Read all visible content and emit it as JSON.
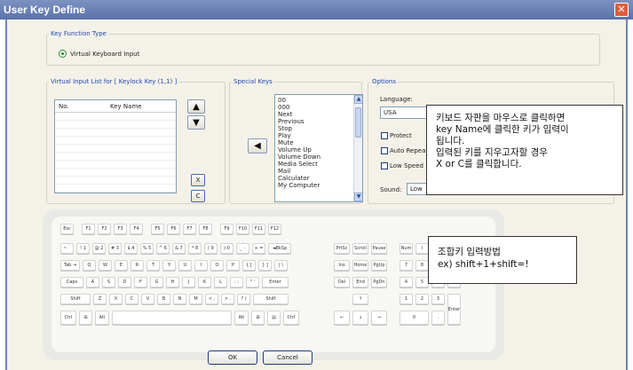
{
  "window": {
    "title": "User Key Define",
    "close_glyph": "✕"
  },
  "key_function": {
    "legend": "Key Function Type",
    "option": "Virtual Keyboard Input"
  },
  "virtual_list": {
    "legend": "Virtual Input List for [ Keylock Key (1,1) ]",
    "columns": [
      "No.",
      "Key Name"
    ],
    "up_glyph": "▲",
    "down_glyph": "▼",
    "delete_label": "X",
    "clear_label": "C"
  },
  "special_keys": {
    "legend": "Special Keys",
    "add_glyph": "◀",
    "items": [
      "00",
      "000",
      "Next",
      "Previous",
      "Stop",
      "Play",
      "Mute",
      "Volume Up",
      "Volume Down",
      "Media Select",
      "Mail",
      "Calculator",
      "My Computer"
    ],
    "scroll_up": "▲",
    "scroll_down": "▼"
  },
  "options": {
    "legend": "Options",
    "language_label": "Language:",
    "language_value": "USA",
    "protect": "Protect",
    "auto_repeat": "Auto Repeat",
    "low_speed": "Low Speed",
    "sound_label": "Sound:",
    "sound_value": "Low"
  },
  "callouts": {
    "top": [
      "키보드 자판을 마우스로 클릭하면",
      "key Name에 클릭한 키가 입력이",
      "됩니다.",
      "입력된 키를 지우고자할 경우",
      "X or C를 클릭합니다."
    ],
    "bottom": [
      "조합키 입력방법",
      "ex) shift+1+shift=!"
    ]
  },
  "keyboard": {
    "fn_row": [
      "Esc",
      "F1",
      "F2",
      "F3",
      "F4",
      "F5",
      "F6",
      "F7",
      "F8",
      "F9",
      "F10",
      "F11",
      "F12"
    ],
    "num_row": [
      "~ `",
      "! 1",
      "@ 2",
      "# 3",
      "$ 4",
      "% 5",
      "^ 6",
      "& 7",
      "* 8",
      "( 9",
      ") 0",
      "_ -",
      "+ =",
      "◄BkSp"
    ],
    "tab_row": [
      "Tab ⇥",
      "Q",
      "W",
      "E",
      "R",
      "T",
      "Y",
      "U",
      "I",
      "O",
      "P",
      "{ [",
      "} ]",
      "| \\"
    ],
    "caps_row": [
      "Caps",
      "A",
      "S",
      "D",
      "F",
      "G",
      "H",
      "J",
      "K",
      "L",
      ": ;",
      "\" '",
      "Enter"
    ],
    "shift_row": [
      "Shift",
      "Z",
      "X",
      "C",
      "V",
      "B",
      "N",
      "M",
      "< ,",
      "> .",
      "? /",
      "Shift"
    ],
    "bottom_row": [
      "Ctrl",
      "⊞",
      "Alt",
      "",
      "Alt",
      "⊞",
      "▤",
      "Ctrl"
    ],
    "nav_top": [
      "PrtSc",
      "Scroll",
      "Pause"
    ],
    "nav_mid": [
      "Ins",
      "Home",
      "PgUp"
    ],
    "nav_low": [
      "Del",
      "End",
      "PgDn"
    ],
    "arrows": [
      "↑",
      "←",
      "↓",
      "→"
    ],
    "numpad_top": [
      "Num",
      "/",
      "*",
      "-"
    ],
    "numpad_r2": [
      "7",
      "8",
      "9"
    ],
    "numpad_r3": [
      "4",
      "5",
      "6"
    ],
    "numpad_r4": [
      "1",
      "2",
      "3"
    ],
    "numpad_r5": [
      "0",
      "."
    ],
    "numpad_plus": "+",
    "numpad_enter": "Enter"
  },
  "footer": {
    "ok": "OK",
    "cancel": "Cancel"
  }
}
